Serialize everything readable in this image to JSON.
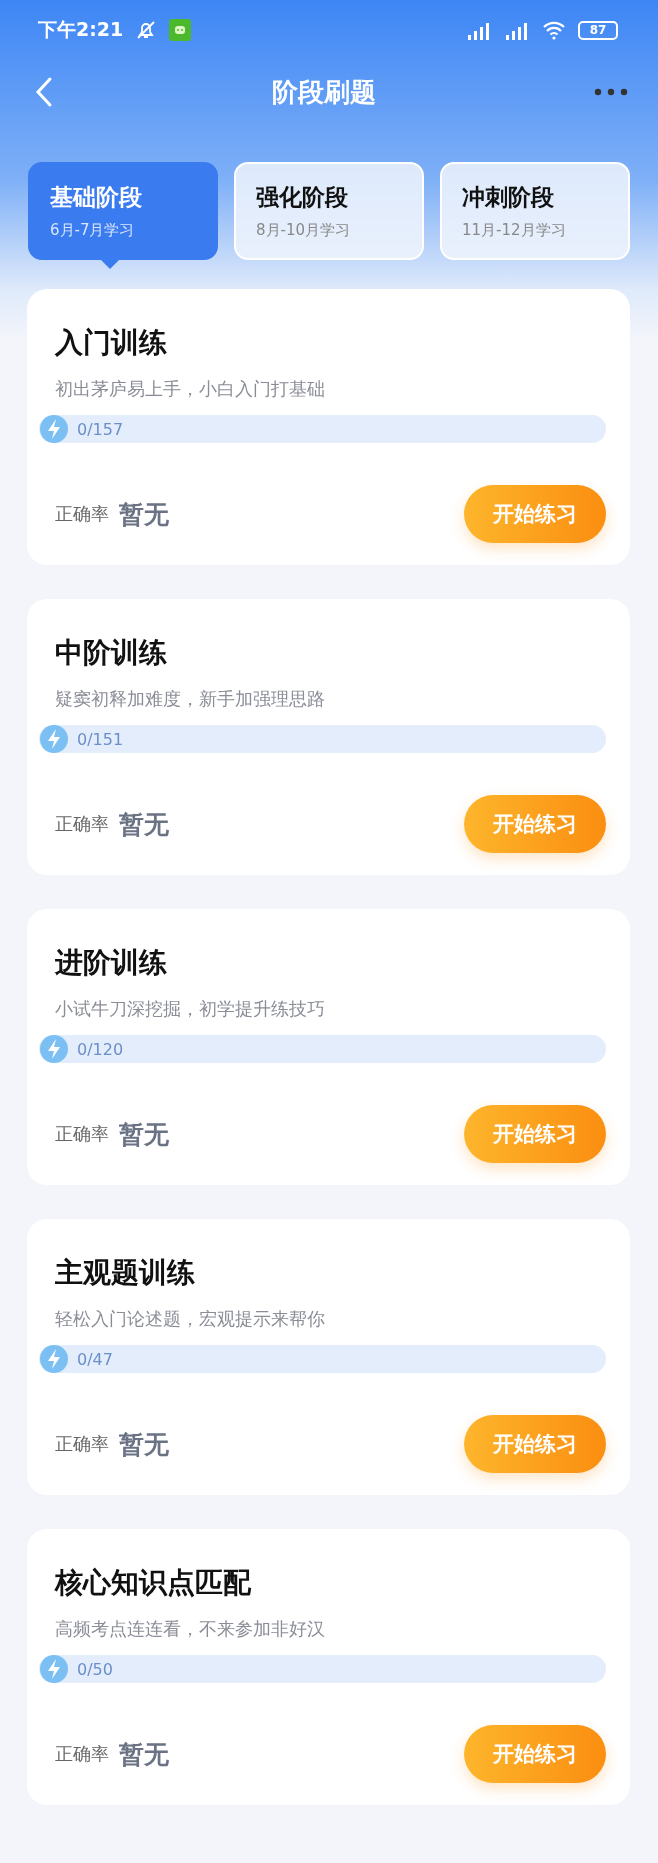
{
  "status_bar": {
    "time": "下午2:21",
    "battery": "87"
  },
  "header": {
    "title": "阶段刷题"
  },
  "tabs": [
    {
      "label": "基础阶段",
      "period": "6月-7月学习",
      "selected": true
    },
    {
      "label": "强化阶段",
      "period": "8月-10月学习",
      "selected": false
    },
    {
      "label": "冲刺阶段",
      "period": "11月-12月学习",
      "selected": false
    }
  ],
  "cards": [
    {
      "title": "入门训练",
      "subtitle": "初出茅庐易上手，小白入门打基础",
      "progress": "0/157",
      "level": 0,
      "accuracy_label": "正确率",
      "accuracy": "暂无",
      "button": "开始练习"
    },
    {
      "title": "中阶训练",
      "subtitle": "疑窦初释加难度，新手加强理思路",
      "progress": "0/151",
      "level": 0,
      "accuracy_label": "正确率",
      "accuracy": "暂无",
      "button": "开始练习"
    },
    {
      "title": "进阶训练",
      "subtitle": "小试牛刀深挖掘，初学提升练技巧",
      "progress": "0/120",
      "level": 0,
      "accuracy_label": "正确率",
      "accuracy": "暂无",
      "button": "开始练习"
    },
    {
      "title": "主观题训练",
      "subtitle": "轻松入门论述题，宏观提示来帮你",
      "progress": "0/47",
      "level": 0,
      "accuracy_label": "正确率",
      "accuracy": "暂无",
      "button": "开始练习"
    },
    {
      "title": "核心知识点匹配",
      "subtitle": "高频考点连连看，不来参加非好汉",
      "progress": "0/50",
      "level": 0,
      "accuracy_label": "正确率",
      "accuracy": "暂无",
      "button": "开始练习"
    }
  ]
}
